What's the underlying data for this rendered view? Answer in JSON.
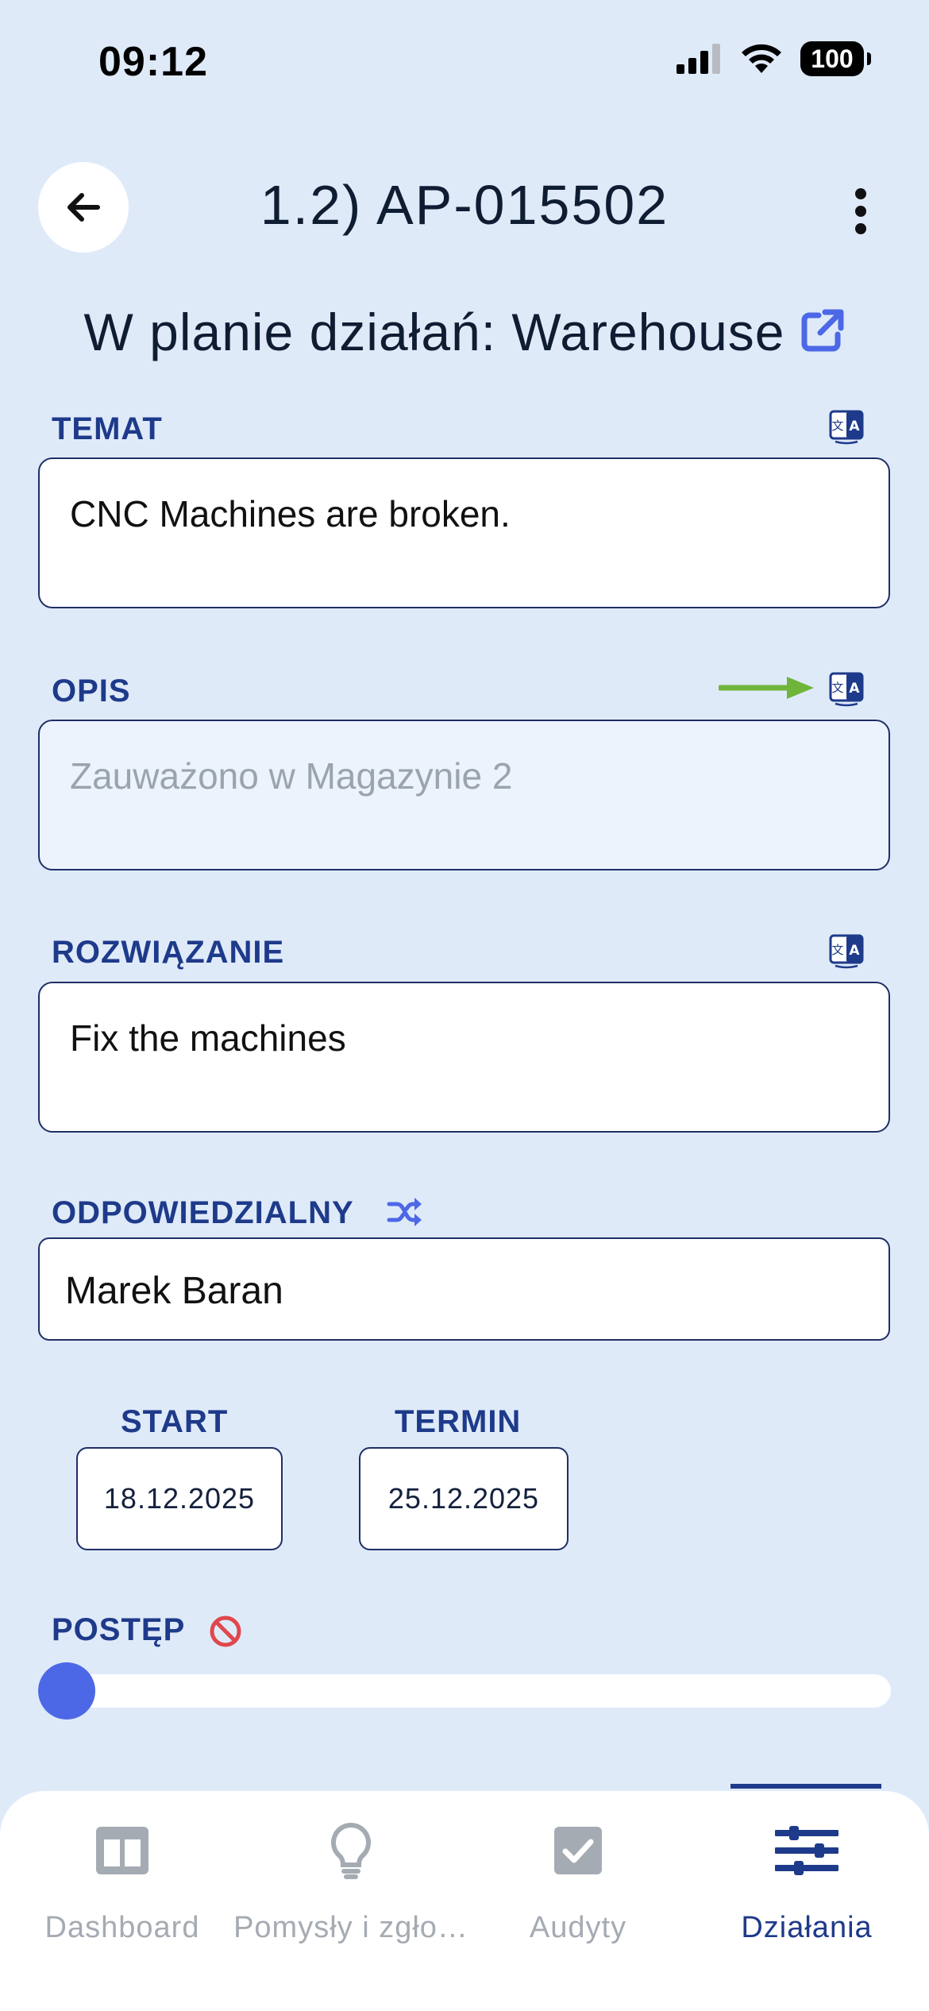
{
  "status_bar": {
    "time": "09:12",
    "battery": "100"
  },
  "header": {
    "title": "1.2) AP-015502"
  },
  "plan": {
    "text": "W planie działań: Warehouse"
  },
  "fields": {
    "temat": {
      "label": "TEMAT",
      "value": "CNC Machines are broken."
    },
    "opis": {
      "label": "OPIS",
      "placeholder": "Zauważono w Magazynie 2"
    },
    "rozwiazanie": {
      "label": "ROZWIĄZANIE",
      "value": "Fix the machines"
    },
    "odpowiedzialny": {
      "label": "ODPOWIEDZIALNY",
      "value": "Marek Baran"
    }
  },
  "dates": {
    "start": {
      "label": "START",
      "value": "18.12.2025"
    },
    "termin": {
      "label": "TERMIN",
      "value": "25.12.2025"
    }
  },
  "progress": {
    "label": "POSTĘP",
    "value": 0
  },
  "tabs": [
    {
      "label": "Dashboard",
      "icon": "dashboard-icon",
      "active": false
    },
    {
      "label": "Pomysły i zgło…",
      "icon": "lightbulb-icon",
      "active": false
    },
    {
      "label": "Audyty",
      "icon": "checkbox-icon",
      "active": false
    },
    {
      "label": "Działania",
      "icon": "sliders-icon",
      "active": true
    }
  ],
  "colors": {
    "background": "#dfeaf9",
    "accent": "#1e3a8a",
    "slider": "#4d68e6",
    "annotation_arrow": "#6fb53a",
    "warning": "#e0474c"
  }
}
